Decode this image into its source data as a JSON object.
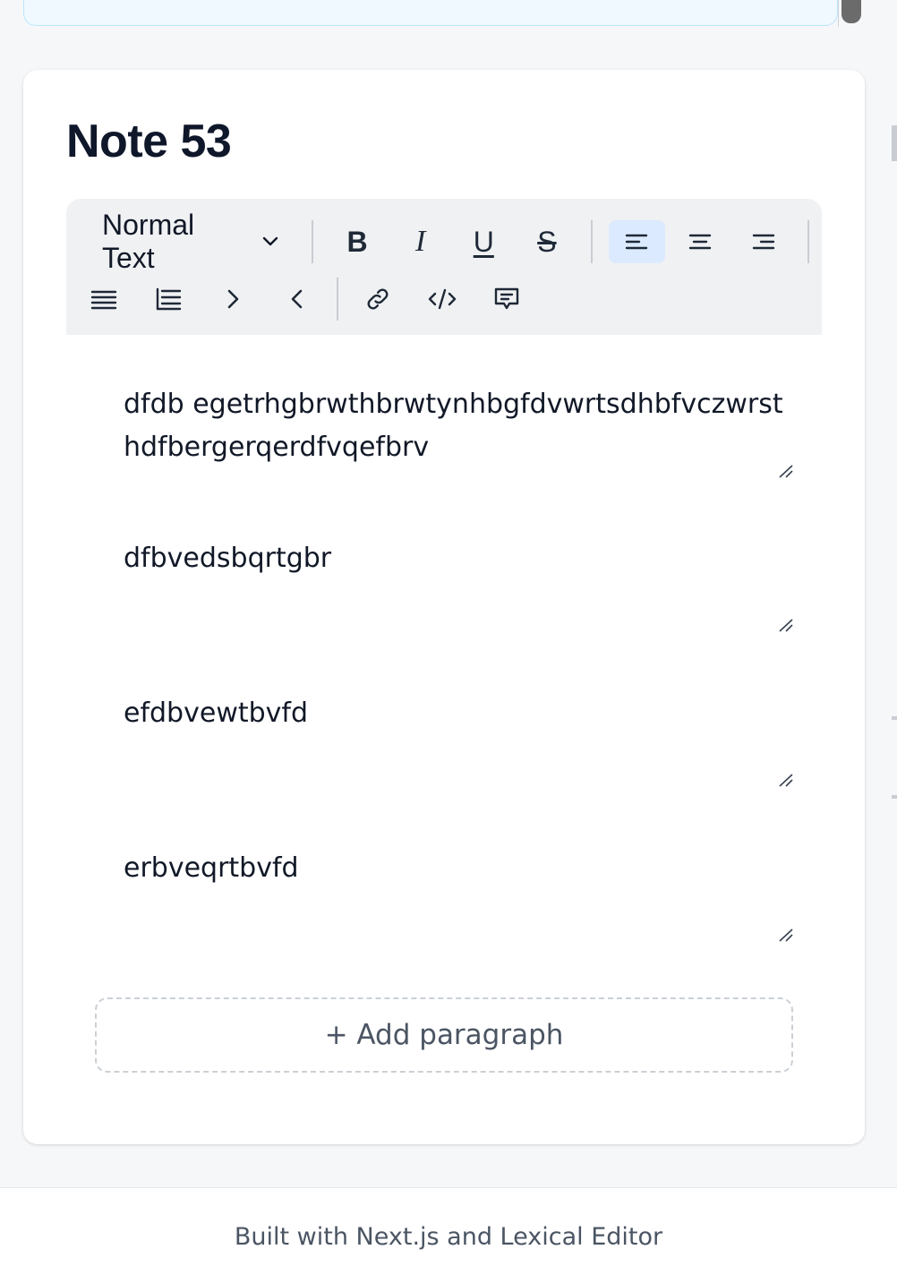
{
  "note": {
    "title": "Note 53"
  },
  "toolbar": {
    "block_type": "Normal Text",
    "bold_label": "B",
    "italic_label": "I",
    "underline_label": "U",
    "strike_label": "S",
    "align_active": "left",
    "icons": [
      "chevron-down-icon",
      "align-left-icon",
      "align-center-icon",
      "align-right-icon",
      "bullet-list-icon",
      "numbered-list-icon",
      "indent-icon",
      "outdent-icon",
      "link-icon",
      "code-icon",
      "comment-icon"
    ]
  },
  "paragraphs": [
    {
      "text": "dfdb egetrhgbrwthbrwtynhbgfdvwrtsdhbfvczwrsthdfbergerqerdfvqefbrv"
    },
    {
      "text": "dfbvedsbqrtgbr"
    },
    {
      "text": "efdbvewtbvfd"
    },
    {
      "text": "erbveqrtbvfd"
    }
  ],
  "add_paragraph_label": "+ Add paragraph",
  "footer": {
    "text": "Built with Next.js and Lexical Editor"
  },
  "colors": {
    "active_button_bg": "#dbeafe",
    "toolbar_bg": "#f0f1f3",
    "page_bg": "#f6f7f9"
  }
}
